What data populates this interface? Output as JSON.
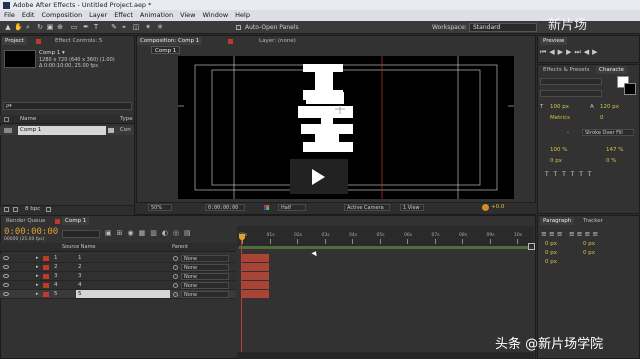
{
  "window": {
    "title": "Adobe After Effects - Untitled Project.aep *"
  },
  "menu": [
    "File",
    "Edit",
    "Composition",
    "Layer",
    "Effect",
    "Animation",
    "View",
    "Window",
    "Help"
  ],
  "toolbar": {
    "auto_open": "Auto-Open Panels",
    "workspace_label": "Workspace:",
    "workspace_value": "Standard"
  },
  "project": {
    "tab": "Project",
    "effect_tab": "Effect Controls: 5",
    "comp_name": "Comp 1 ▾",
    "comp_info1": "1280 x 720  (640 x 360) (1.00)",
    "comp_info2": "Δ 0:00:10:00, 25.00 fps",
    "search_placeholder": "ρ▾",
    "col_name": "Name",
    "col_type": "Type",
    "item_name": "Comp 1",
    "item_type": "Con",
    "bpc": "8 bpc"
  },
  "comp": {
    "tab": "Composition: Comp 1",
    "layer_tab": "Layer: (none)",
    "sub_tab": "Comp 1",
    "zoom": "50%",
    "timecode": "0:00:00:00",
    "quality": "Half",
    "camera": "Active Camera",
    "views": "1 View",
    "exposure": "+0.0"
  },
  "right": {
    "preview": "Preview",
    "effects": "Effects & Presets",
    "character": "Characte",
    "font_size": "100 px",
    "leading": "120 px",
    "metrics": "Metrics",
    "tracking": "0",
    "stroke": "Stroke Over Fill",
    "v_scale": "100 %",
    "h_scale": "147 %",
    "baseline": "0 px",
    "tsume": "0 %",
    "para_tab": "Paragraph",
    "tracker_tab": "Tracker",
    "px_vals": [
      "0 px",
      "0 px",
      "0 px",
      "0 px",
      "0 px"
    ]
  },
  "timeline": {
    "render_tab": "Render Queue",
    "comp_tab": "Comp 1",
    "timecode": "0:00:00:00",
    "timecode_sub": "00000 (25.00 fps)",
    "col_source": "Source Name",
    "col_parent": "Parent",
    "ticks": [
      "00s",
      "01s",
      "02s",
      "03s",
      "04s",
      "05s",
      "06s",
      "07s",
      "08s",
      "09s",
      "10s"
    ],
    "layers": [
      {
        "num": "1",
        "name": "1",
        "parent": "None"
      },
      {
        "num": "2",
        "name": "2",
        "parent": "None"
      },
      {
        "num": "3",
        "name": "3",
        "parent": "None"
      },
      {
        "num": "4",
        "name": "4",
        "parent": "None"
      },
      {
        "num": "5",
        "name": "5",
        "parent": "None"
      }
    ]
  },
  "watermark": {
    "top": "新片场",
    "bottom": "头条 @新片场学院"
  }
}
